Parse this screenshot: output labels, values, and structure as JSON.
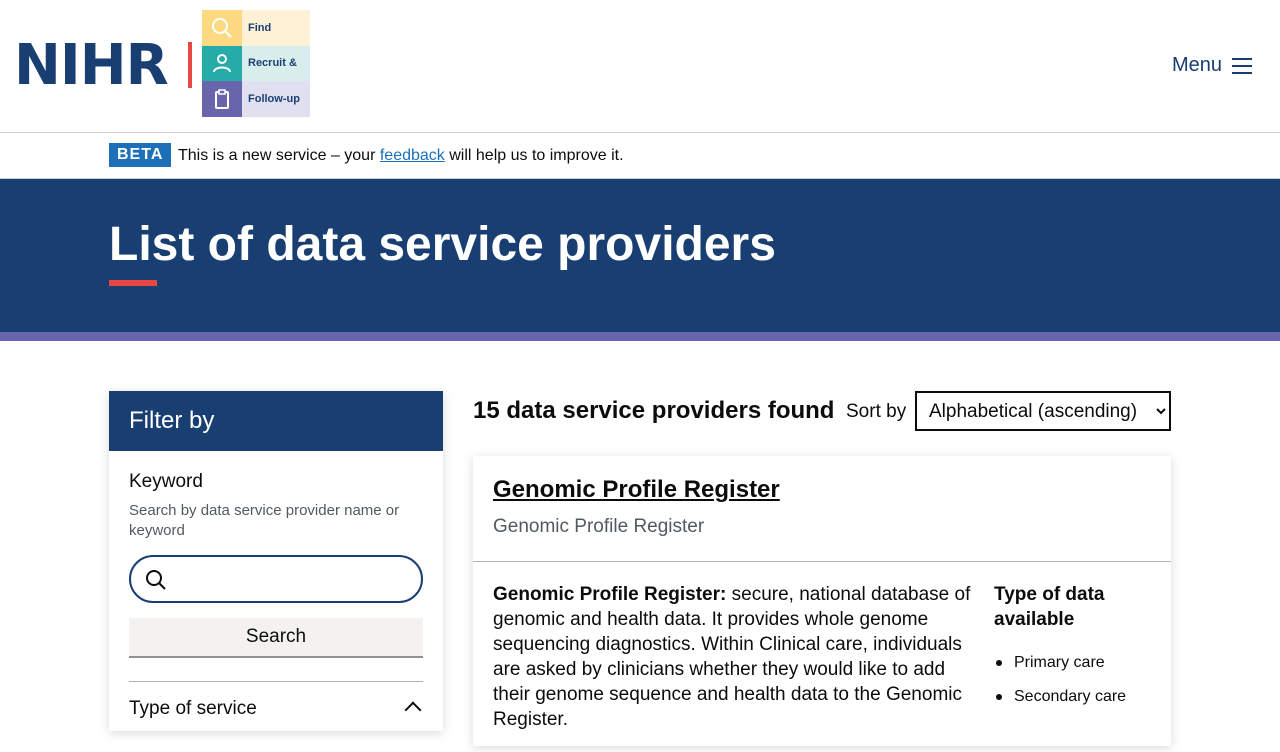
{
  "header": {
    "logo_text": "NIHR",
    "logo_rows": [
      {
        "icon": "search-icon",
        "label": "Find"
      },
      {
        "icon": "person-icon",
        "label": "Recruit &"
      },
      {
        "icon": "clipboard-icon",
        "label": "Follow-up"
      }
    ],
    "menu_label": "Menu"
  },
  "beta": {
    "tag": "BETA",
    "text_before": "This is a new service – your ",
    "link": "feedback",
    "text_after": " will help us to improve it."
  },
  "hero": {
    "title": "List of data service providers"
  },
  "filter": {
    "heading": "Filter by",
    "keyword_label": "Keyword",
    "keyword_hint": "Search by data service provider name or keyword",
    "search_value": "",
    "search_button": "Search",
    "type_of_service_label": "Type of service"
  },
  "results": {
    "count_text": "15 data service providers found",
    "sort_label": "Sort by",
    "sort_selected": "Alphabetical (ascending)"
  },
  "card": {
    "title": "Genomic Profile Register",
    "subtitle": "Genomic Profile Register",
    "desc_lead": "Genomic Profile Register:",
    "desc_text": " secure, national database of genomic and health data. It provides whole genome sequencing diagnostics. Within Clinical care, individuals are asked by clinicians whether they would like to add their genome sequence and health data to the Genomic Register.",
    "data_heading": "Type of data available",
    "data_items": [
      "Primary care",
      "Secondary care"
    ]
  },
  "colors": {
    "navy": "#193e72",
    "accent_red": "#e8483f",
    "purple_strip": "#6865ad",
    "beta_blue": "#1d70b8"
  }
}
